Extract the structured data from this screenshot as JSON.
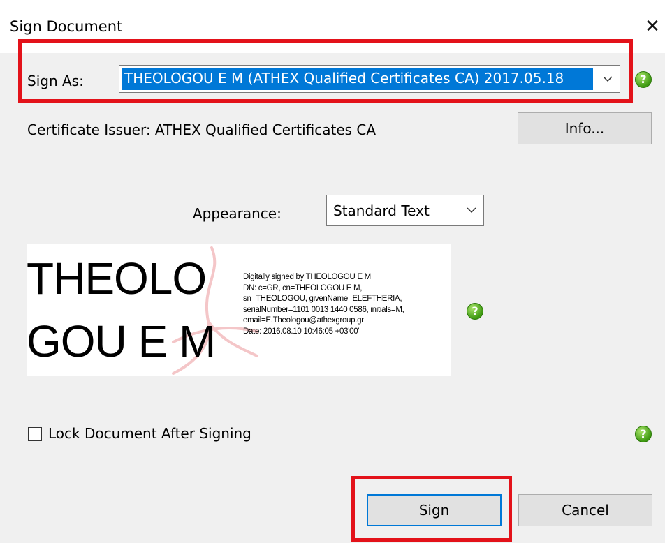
{
  "window": {
    "title": "Sign Document",
    "close_glyph": "✕"
  },
  "sign_as": {
    "label": "Sign As:",
    "selected": "THEOLOGOU E M (ATHEX Qualified Certificates CA) 2017.05.18"
  },
  "certificate": {
    "issuer_text": "Certificate Issuer: ATHEX Qualified Certificates CA",
    "info_button": "Info..."
  },
  "appearance": {
    "label": "Appearance:",
    "selected": "Standard Text"
  },
  "preview": {
    "name_line1": "THEOLO",
    "name_line2": "GOU E M",
    "details": [
      "Digitally signed by THEOLOGOU E M",
      "DN: c=GR, cn=THEOLOGOU E M,",
      "sn=THEOLOGOU, givenName=ELEFTHERIA,",
      "serialNumber=1101 0013 1440 0586, initials=M,",
      "email=E.Theologou@athexgroup.gr",
      "Date: 2016.08.10 10:46:05 +03'00'"
    ]
  },
  "lock": {
    "label": "Lock Document After Signing",
    "checked": false
  },
  "buttons": {
    "sign": "Sign",
    "cancel": "Cancel"
  },
  "help_glyph": "?",
  "colors": {
    "selection": "#0078d7",
    "highlight": "#e3121a",
    "help_green": "#3f9a12"
  }
}
